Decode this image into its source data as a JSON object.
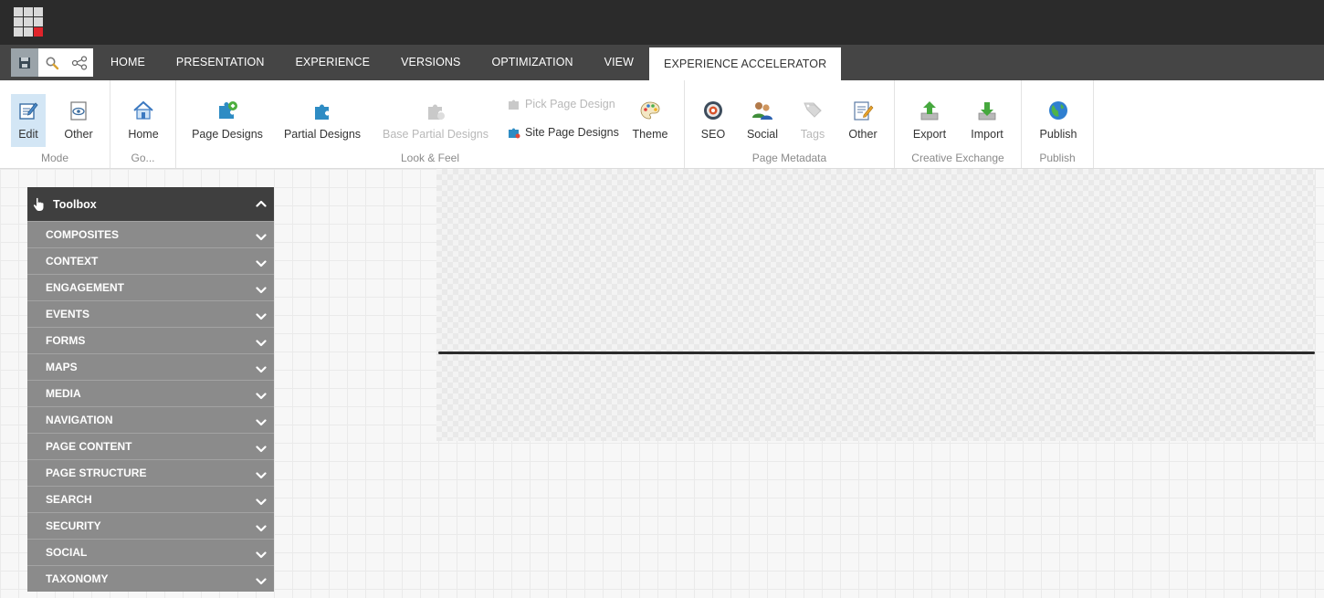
{
  "tabs": [
    {
      "label": "HOME",
      "active": false
    },
    {
      "label": "PRESENTATION",
      "active": false
    },
    {
      "label": "EXPERIENCE",
      "active": false
    },
    {
      "label": "VERSIONS",
      "active": false
    },
    {
      "label": "OPTIMIZATION",
      "active": false
    },
    {
      "label": "VIEW",
      "active": false
    },
    {
      "label": "EXPERIENCE ACCELERATOR",
      "active": true
    }
  ],
  "quick_toolbar": [
    "save-icon",
    "search-icon",
    "navigator-icon"
  ],
  "ribbon": {
    "mode": {
      "label": "Mode",
      "edit": "Edit",
      "other": "Other"
    },
    "go": {
      "label": "Go...",
      "home": "Home"
    },
    "look_feel": {
      "label": "Look & Feel",
      "page_designs": "Page Designs",
      "partial_designs": "Partial Designs",
      "base_partial_designs": "Base Partial Designs",
      "pick_page_design": "Pick Page Design",
      "site_page_designs": "Site Page Designs",
      "theme": "Theme"
    },
    "page_metadata": {
      "label": "Page Metadata",
      "seo": "SEO",
      "social": "Social",
      "tags": "Tags",
      "other": "Other"
    },
    "creative_exchange": {
      "label": "Creative Exchange",
      "export": "Export",
      "import": "Import"
    },
    "publish": {
      "label": "Publish",
      "publish": "Publish"
    }
  },
  "toolbox": {
    "title": "Toolbox",
    "categories": [
      "COMPOSITES",
      "CONTEXT",
      "ENGAGEMENT",
      "EVENTS",
      "FORMS",
      "MAPS",
      "MEDIA",
      "NAVIGATION",
      "PAGE CONTENT",
      "PAGE STRUCTURE",
      "SEARCH",
      "SECURITY",
      "SOCIAL",
      "TAXONOMY"
    ]
  },
  "colors": {
    "topbar": "#2b2b2b",
    "tabbar": "#454545",
    "toolbox_header": "#3f3f3f",
    "toolbox_item": "#8b8b8b",
    "selected": "#d3e6f5",
    "launch_red": "#e0242b"
  }
}
